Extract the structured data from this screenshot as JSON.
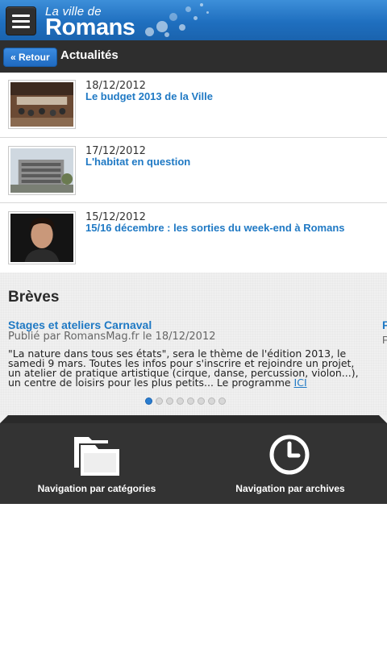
{
  "header": {
    "logo_small": "La ville de",
    "logo_big": "Romans"
  },
  "toolbar": {
    "back_label": "« Retour",
    "title": "Actualités"
  },
  "news": [
    {
      "date": "18/12/2012",
      "title": "Le budget 2013 de la Ville"
    },
    {
      "date": "17/12/2012",
      "title": "L'habitat en question"
    },
    {
      "date": "15/12/2012",
      "title": "15/16 décembre : les sorties du week-end à Romans"
    }
  ],
  "breves": {
    "section_title": "Brèves",
    "current": {
      "title": "Stages et ateliers Carnaval",
      "meta": "Publié par RomansMag.fr le 18/12/2012",
      "body": "\"La nature dans tous ses états\", sera le thème de l'édition 2013, le samedi 9 mars. Toutes les infos pour s'inscrire et rejoindre un projet, un atelier de pratique artistique (cirque, danse, percussion, violon...), un centre de loisirs pour les plus petits... Le programme ",
      "link": "ICI"
    },
    "next_peek": {
      "title": "F",
      "meta": "P"
    },
    "pagination": {
      "total": 8,
      "active_index": 0
    }
  },
  "bottom_nav": {
    "categories_label": "Navigation par catégories",
    "archives_label": "Navigation par archives"
  },
  "colors": {
    "accent": "#1f79c4",
    "header_blue": "#1f6fbf",
    "toolbar": "#2e2e2e",
    "bottom_bar": "#333333"
  },
  "icons": {
    "menu": "hamburger-icon",
    "categories": "folders-icon",
    "archives": "clock-icon"
  }
}
